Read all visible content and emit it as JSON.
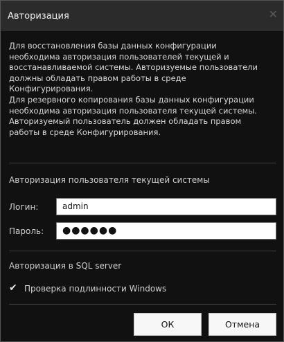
{
  "window": {
    "title": "Авторизация",
    "close_icon": "close-icon"
  },
  "description": {
    "lines": [
      "Для восстановления базы данных конфигурации",
      "необходима авторизация пользователей текущей и",
      "восстанавливаемой системы. Авторизуемые пользователи",
      "должны обладать правом работы в среде",
      "Конфигурирования.",
      "Для резервного копирования базы данных конфигурации",
      "необходима авторизация пользователя текущей системы.",
      "Авторизуемый пользователь должен обладать правом",
      "работы в среде Конфигурирования."
    ]
  },
  "current_user": {
    "section_title": "Авторизация пользователя текущей системы",
    "login_label": "Логин:",
    "login_value": "admin",
    "password_label": "Пароль:",
    "password_value": "●●●●●●"
  },
  "sql": {
    "section_title": "Авторизация в SQL server",
    "windows_auth_label": "Проверка подлинности Windows",
    "windows_auth_checked": true,
    "check_glyph": "✔"
  },
  "buttons": {
    "ok": "ОК",
    "cancel": "Отмена"
  },
  "colors": {
    "background": "#111111",
    "titlebar": "#2b2b2b",
    "text": "#d0d0d0",
    "button_bg": "#f7f7f7"
  }
}
